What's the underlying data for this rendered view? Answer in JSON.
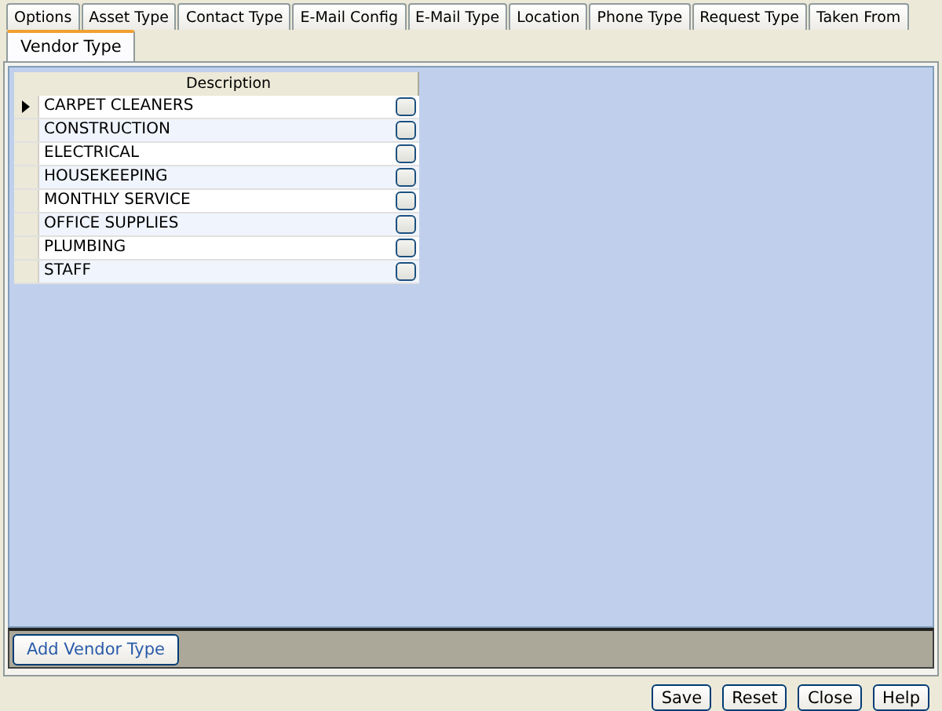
{
  "tab_rows": [
    [
      {
        "label": "Options",
        "selected": false
      },
      {
        "label": "Asset Type",
        "selected": false
      },
      {
        "label": "Contact Type",
        "selected": false
      },
      {
        "label": "E-Mail Config",
        "selected": false
      },
      {
        "label": "E-Mail Type",
        "selected": false
      },
      {
        "label": "Location",
        "selected": false
      },
      {
        "label": "Phone Type",
        "selected": false
      },
      {
        "label": "Request Type",
        "selected": false
      },
      {
        "label": "Taken From",
        "selected": false
      }
    ],
    [
      {
        "label": "Vendor Type",
        "selected": true
      }
    ]
  ],
  "grid": {
    "columns": [
      "Description"
    ],
    "rows": [
      {
        "description": "CARPET CLEANERS",
        "current": true,
        "checked": false
      },
      {
        "description": "CONSTRUCTION",
        "current": false,
        "checked": false
      },
      {
        "description": "ELECTRICAL",
        "current": false,
        "checked": false
      },
      {
        "description": "HOUSEKEEPING",
        "current": false,
        "checked": false
      },
      {
        "description": "MONTHLY SERVICE",
        "current": false,
        "checked": false
      },
      {
        "description": "OFFICE SUPPLIES",
        "current": false,
        "checked": false
      },
      {
        "description": "PLUMBING",
        "current": false,
        "checked": false
      },
      {
        "description": "STAFF",
        "current": false,
        "checked": false
      }
    ]
  },
  "add_button": "Add Vendor Type",
  "buttons": [
    "Save",
    "Reset",
    "Close",
    "Help"
  ]
}
